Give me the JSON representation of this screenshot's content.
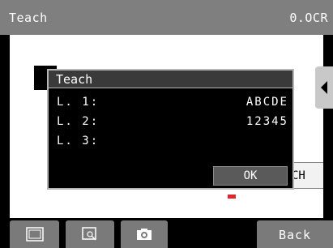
{
  "titlebar": {
    "title": "Teach",
    "mode": "0.OCR"
  },
  "dialog": {
    "title": "Teach",
    "rows": [
      {
        "label": "L. 1:",
        "value": "ABCDE"
      },
      {
        "label": "L. 2:",
        "value": "12345"
      },
      {
        "label": "L. 3:",
        "value": ""
      }
    ],
    "ok_label": "OK"
  },
  "teach_button_partial": "CH",
  "toolbar": {
    "icons": [
      "frame-icon",
      "zoom-icon",
      "camera-icon"
    ],
    "back_label": "Back"
  },
  "colors": {
    "titlebar": "#7f7f7f",
    "accent_red": "#e0262b",
    "button": "#7a7a7a"
  }
}
